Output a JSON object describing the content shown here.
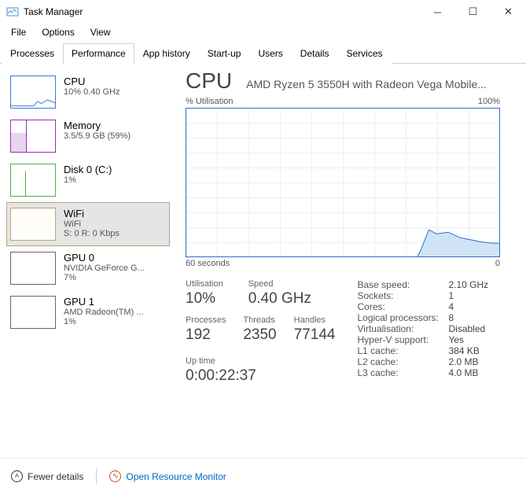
{
  "window": {
    "title": "Task Manager"
  },
  "menu": {
    "file": "File",
    "options": "Options",
    "view": "View"
  },
  "tabs": {
    "processes": "Processes",
    "performance": "Performance",
    "app_history": "App history",
    "start_up": "Start-up",
    "users": "Users",
    "details": "Details",
    "services": "Services"
  },
  "sidebar": {
    "cpu": {
      "title": "CPU",
      "sub": "10% 0.40 GHz"
    },
    "mem": {
      "title": "Memory",
      "sub": "3.5/5.9 GB (59%)"
    },
    "disk": {
      "title": "Disk 0 (C:)",
      "sub": "1%"
    },
    "wifi": {
      "title": "WiFi",
      "sub1": "WiFi",
      "sub2": "S: 0 R: 0 Kbps"
    },
    "gpu0": {
      "title": "GPU 0",
      "sub1": "NVIDIA GeForce G...",
      "sub2": "7%"
    },
    "gpu1": {
      "title": "GPU 1",
      "sub1": "AMD Radeon(TM) ...",
      "sub2": "1%"
    }
  },
  "main": {
    "title": "CPU",
    "subtitle": "AMD Ryzen 5 3550H with Radeon Vega Mobile...",
    "chart_top_left": "% Utilisation",
    "chart_top_right": "100%",
    "chart_bottom_left": "60 seconds",
    "chart_bottom_right": "0",
    "util_label": "Utilisation",
    "util_value": "10%",
    "speed_label": "Speed",
    "speed_value": "0.40 GHz",
    "proc_label": "Processes",
    "proc_value": "192",
    "threads_label": "Threads",
    "threads_value": "2350",
    "handles_label": "Handles",
    "handles_value": "77144",
    "uptime_label": "Up time",
    "uptime_value": "0:00:22:37"
  },
  "right": {
    "base_speed_k": "Base speed:",
    "base_speed_v": "2.10 GHz",
    "sockets_k": "Sockets:",
    "sockets_v": "1",
    "cores_k": "Cores:",
    "cores_v": "4",
    "lp_k": "Logical processors:",
    "lp_v": "8",
    "virt_k": "Virtualisation:",
    "virt_v": "Disabled",
    "hv_k": "Hyper-V support:",
    "hv_v": "Yes",
    "l1_k": "L1 cache:",
    "l1_v": "384 KB",
    "l2_k": "L2 cache:",
    "l2_v": "2.0 MB",
    "l3_k": "L3 cache:",
    "l3_v": "4.0 MB"
  },
  "footer": {
    "fewer": "Fewer details",
    "orm": "Open Resource Monitor"
  },
  "chart_data": {
    "type": "line",
    "title": "% Utilisation",
    "xlabel": "seconds",
    "ylabel": "%",
    "xlim": [
      60,
      0
    ],
    "ylim": [
      0,
      100
    ],
    "x": [
      60,
      55,
      50,
      45,
      40,
      35,
      30,
      25,
      20,
      18,
      16,
      14,
      12,
      10,
      8,
      6,
      4,
      2,
      0
    ],
    "values": [
      0,
      0,
      0,
      0,
      0,
      0,
      0,
      0,
      0,
      0,
      5,
      20,
      17,
      18,
      14,
      13,
      11,
      10,
      10
    ]
  }
}
